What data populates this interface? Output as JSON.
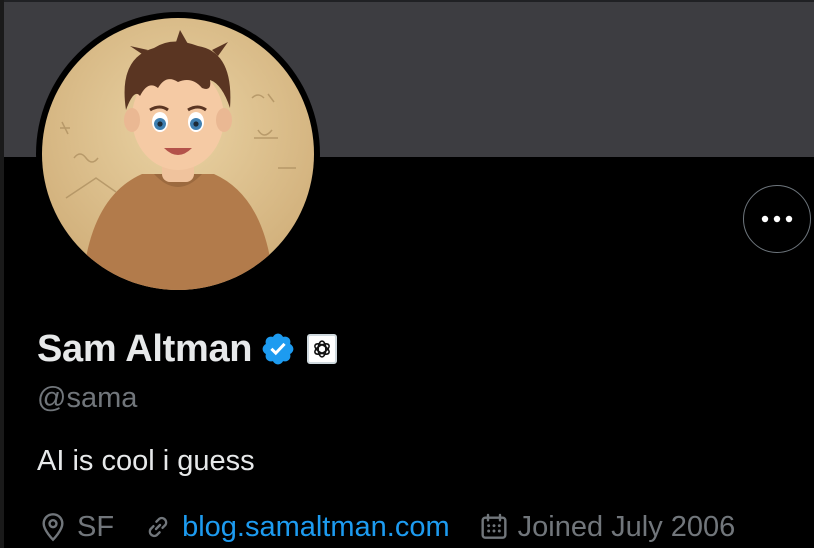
{
  "profile": {
    "display_name": "Sam Altman",
    "handle": "@sama",
    "bio": "AI is cool i guess",
    "location": "SF",
    "website": "blog.samaltman.com",
    "joined": "Joined July 2006"
  },
  "icons": {
    "verified": "verified-badge-icon",
    "affiliate": "openai-logo-icon",
    "location": "location-pin-icon",
    "website": "link-icon",
    "joined": "calendar-icon",
    "more": "more-options-icon"
  },
  "colors": {
    "background": "#000000",
    "banner": "#3d3d41",
    "primary_text": "#e7e9ea",
    "secondary_text": "#71767b",
    "accent": "#1d9bf0"
  }
}
